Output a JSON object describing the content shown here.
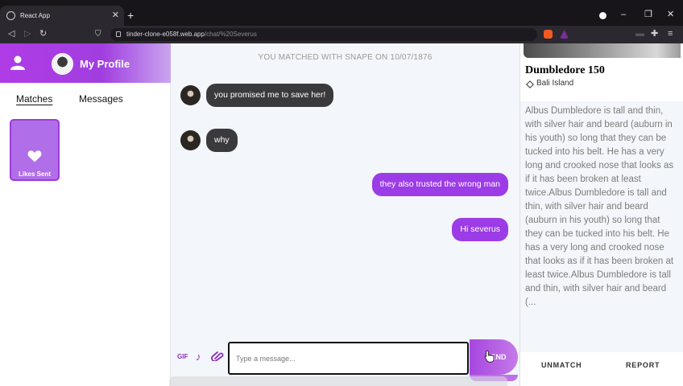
{
  "browser": {
    "tab_title": "React App",
    "url_host": "tinder-clone-e058f.web.app",
    "url_path": "/chat/%20Severus"
  },
  "sidebar": {
    "profile_title": "My Profile",
    "tabs": [
      {
        "label": "Matches",
        "active": true
      },
      {
        "label": "Messages",
        "active": false
      }
    ],
    "likes_card_label": "Likes Sent"
  },
  "chat": {
    "match_notice": "YOU MATCHED WITH SNAPE ON 10/07/1876",
    "messages": [
      {
        "from": "them",
        "text": "you promised me to save her!"
      },
      {
        "from": "them",
        "text": "why"
      },
      {
        "from": "me",
        "text": "they also trusted the wrong man"
      },
      {
        "from": "me",
        "text": "Hi severus"
      }
    ],
    "composer": {
      "gif_label": "GIF",
      "placeholder": "Type a message...",
      "send_label": "SEND"
    }
  },
  "profile_panel": {
    "name": "Dumbledore 150",
    "location": "Bali Island",
    "bio": "Albus Dumbledore is tall and thin, with silver hair and beard (auburn in his youth) so long that they can be tucked into his belt. He has a very long and crooked nose that looks as if it has been broken at least twice.Albus Dumbledore is tall and thin, with silver hair and beard (auburn in his youth) so long that they can be tucked into his belt. He has a very long and crooked nose that looks as if it has been broken at least twice.Albus Dumbledore is tall and thin, with silver hair and beard (...",
    "unmatch_label": "UNMATCH",
    "report_label": "REPORT"
  },
  "colors": {
    "accent": "#9c3ce6",
    "incoming_bubble": "#3a3a3c",
    "chat_bg": "#f3f6fa"
  }
}
